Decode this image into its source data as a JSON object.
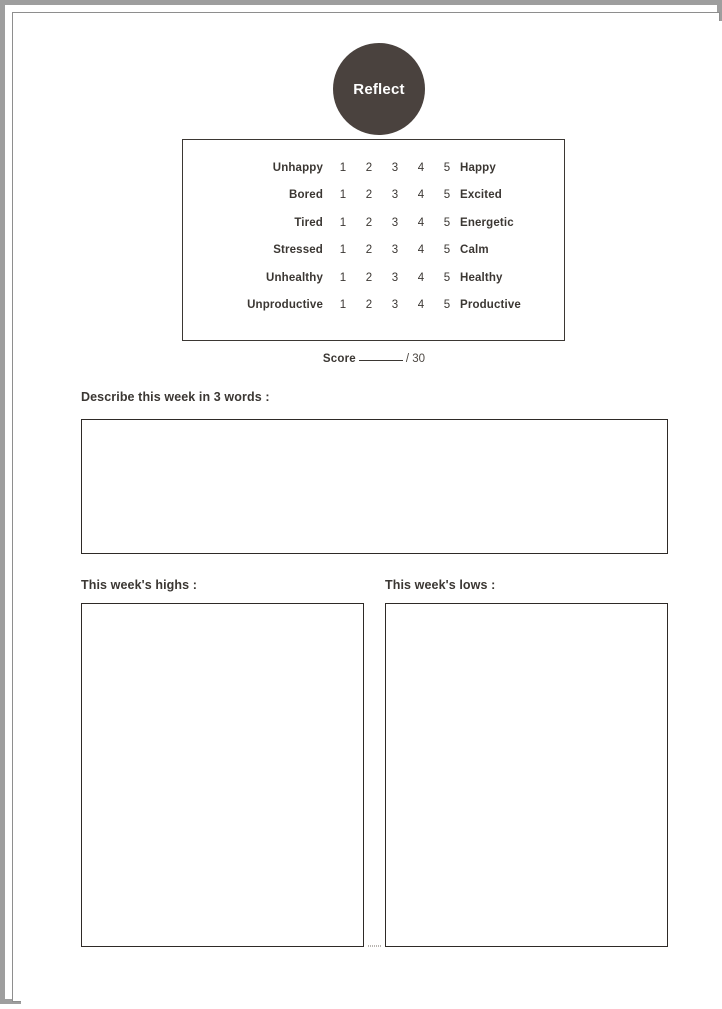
{
  "page": {
    "title_badge": "Reflect"
  },
  "rating": {
    "scale": [
      "1",
      "2",
      "3",
      "4",
      "5"
    ],
    "rows": [
      {
        "negative": "Unhappy",
        "positive": "Happy"
      },
      {
        "negative": "Bored",
        "positive": "Excited"
      },
      {
        "negative": "Tired",
        "positive": "Energetic"
      },
      {
        "negative": "Stressed",
        "positive": "Calm"
      },
      {
        "negative": "Unhealthy",
        "positive": "Healthy"
      },
      {
        "negative": "Unproductive",
        "positive": "Productive"
      }
    ]
  },
  "score": {
    "label": "Score",
    "value": "",
    "total": "/ 30"
  },
  "sections": {
    "describe": {
      "caption": "Describe this week in 3 words :",
      "value": ""
    },
    "highs": {
      "caption": "This week's highs :",
      "value": ""
    },
    "lows": {
      "caption": "This week's lows :",
      "value": ""
    }
  },
  "colors": {
    "badge_background": "#4a423e",
    "badge_text": "#ffffff",
    "ink": "#3b3733",
    "box_border": "#2e2a27",
    "page_frame": "#9e9e9e"
  }
}
